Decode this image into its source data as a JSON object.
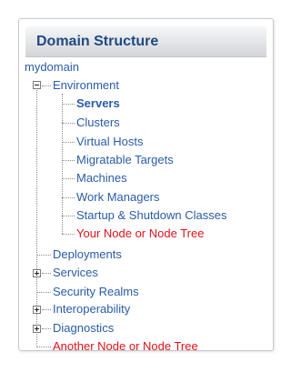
{
  "panel": {
    "title": "Domain Structure"
  },
  "tree": {
    "root": "mydomain",
    "environment": {
      "label": "Environment",
      "expanded": true,
      "children": {
        "servers": "Servers",
        "clusters": "Clusters",
        "virtual_hosts": "Virtual Hosts",
        "migratable_targets": "Migratable Targets",
        "machines": "Machines",
        "work_managers": "Work Managers",
        "startup_shutdown": "Startup & Shutdown Classes",
        "your_node": "Your Node or Node Tree"
      }
    },
    "deployments": "Deployments",
    "services": {
      "label": "Services",
      "expanded": false
    },
    "security_realms": "Security Realms",
    "interoperability": {
      "label": "Interoperability",
      "expanded": false
    },
    "diagnostics": {
      "label": "Diagnostics",
      "expanded": false
    },
    "another_node": "Another Node or Node Tree"
  },
  "colors": {
    "link": "#2a5ba8",
    "highlight": "#e0121b",
    "header_text": "#1f4a82"
  }
}
